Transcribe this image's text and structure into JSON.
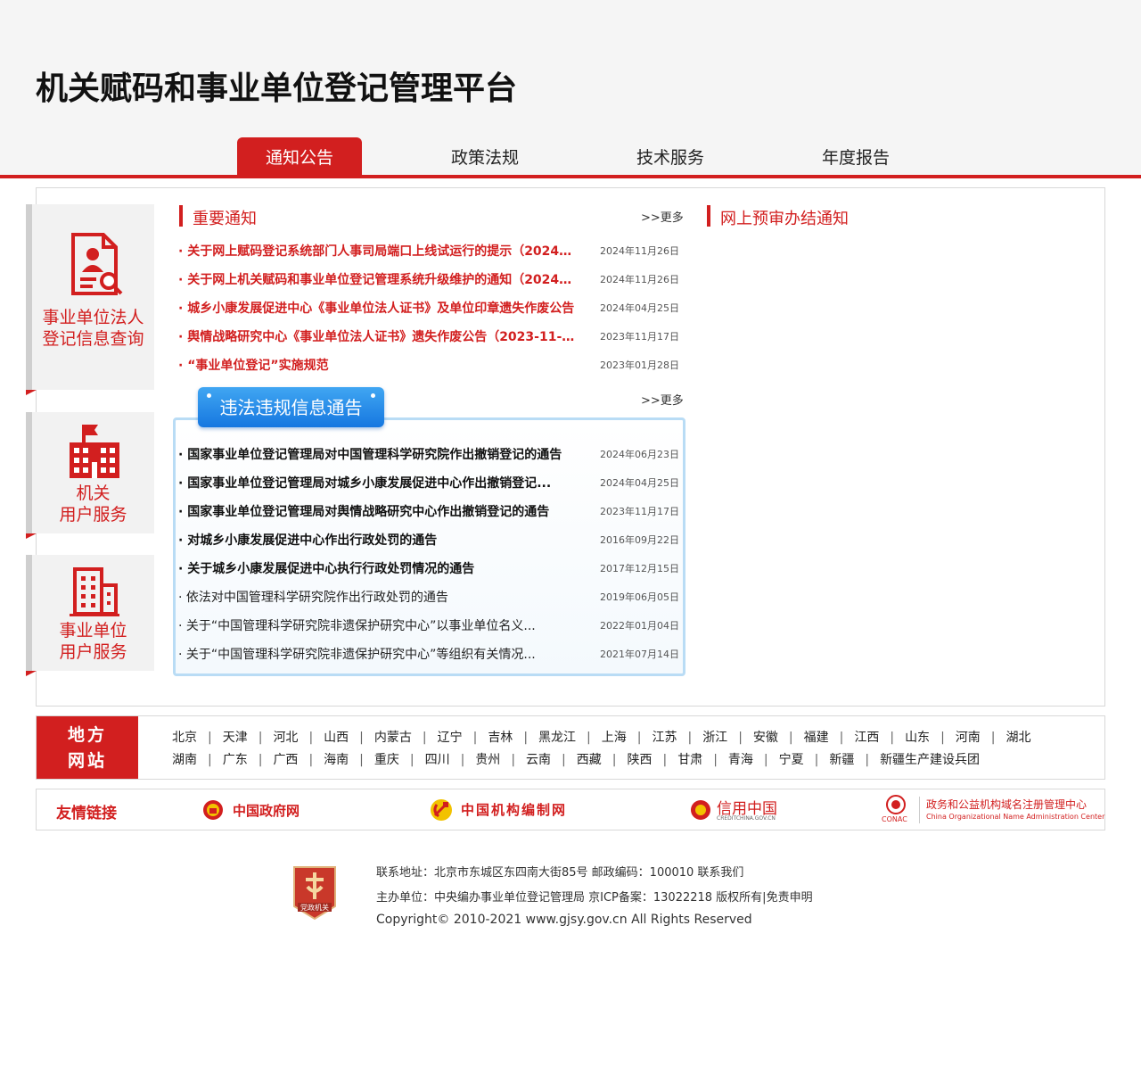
{
  "header": {
    "site_title": "机关赋码和事业单位登记管理平台",
    "nav_tabs": [
      {
        "label": "通知公告"
      },
      {
        "label": "政策法规"
      },
      {
        "label": "技术服务"
      },
      {
        "label": "年度报告"
      }
    ],
    "active_tab": "通知公告",
    "accent_color": "#d21f1f"
  },
  "sidebar": {
    "cards": [
      {
        "label_line1": "事业单位法人",
        "label_line2": "登记信息查询",
        "icon": "person-search-icon"
      },
      {
        "label_line1": "机关",
        "label_line2": "用户服务",
        "icon": "office-building-flag-icon"
      },
      {
        "label_line1": "事业单位",
        "label_line2": "用户服务",
        "icon": "building-icon"
      }
    ]
  },
  "notices": {
    "title": "重要通知",
    "more": ">>更多",
    "items": [
      {
        "text": "· 关于网上赋码登记系统部门人事司局端口上线试运行的提示（2024年11月26日）",
        "date": "2024年11月26日"
      },
      {
        "text": "· 关于网上机关赋码和事业单位登记管理系统升级维护的通知（2024年11月26日）",
        "date": "2024年11月26日"
      },
      {
        "text": "· 城乡小康发展促进中心《事业单位法人证书》及单位印章遗失作废公告",
        "date": "2024年04月25日"
      },
      {
        "text": "· 舆情战略研究中心《事业单位法人证书》遗失作废公告（2023-11-17）",
        "date": "2023年11月17日"
      },
      {
        "text": "· “事业单位登记”实施规范",
        "date": "2023年01月28日"
      }
    ]
  },
  "prereview": {
    "title": "网上预审办结通知"
  },
  "illegal": {
    "badge": "违法违规信息通告",
    "more": ">>更多",
    "items": [
      {
        "text": "· 国家事业单位登记管理局对中国管理科学研究院作出撤销登记的通告",
        "date": "2024年06月23日",
        "style": "black"
      },
      {
        "text": "· 国家事业单位登记管理局对城乡小康发展促进中心作出撤销登记...",
        "date": "2024年04月25日",
        "style": "black"
      },
      {
        "text": "· 国家事业单位登记管理局对舆情战略研究中心作出撤销登记的通告",
        "date": "2023年11月17日",
        "style": "black"
      },
      {
        "text": "· 对城乡小康发展促进中心作出行政处罚的通告",
        "date": "2016年09月22日",
        "style": "black"
      },
      {
        "text": "· 关于城乡小康发展促进中心执行行政处罚情况的通告",
        "date": "2017年12月15日",
        "style": "black"
      },
      {
        "text": "· 依法对中国管理科学研究院作出行政处罚的通告",
        "date": "2019年06月05日",
        "style": "normal"
      },
      {
        "text": "· 关于“中国管理科学研究院非遗保护研究中心”以事业单位名义...",
        "date": "2022年01月04日",
        "style": "normal"
      },
      {
        "text": "· 关于“中国管理科学研究院非遗保护研究中心”等组织有关情况...",
        "date": "2021年07月14日",
        "style": "normal"
      }
    ]
  },
  "regions": {
    "tag_line1": "地方",
    "tag_line2": "网站",
    "row1": [
      "北京",
      "天津",
      "河北",
      "山西",
      "内蒙古",
      "辽宁",
      "吉林",
      "黑龙江",
      "上海",
      "江苏",
      "浙江",
      "安徽",
      "福建",
      "江西",
      "山东",
      "河南",
      "湖北"
    ],
    "row2": [
      "湖南",
      "广东",
      "广西",
      "海南",
      "重庆",
      "四川",
      "贵州",
      "云南",
      "西藏",
      "陕西",
      "甘肃",
      "青海",
      "宁夏",
      "新疆",
      "新疆生产建设兵团"
    ]
  },
  "friend_links": {
    "tag": "友情链接",
    "items": [
      {
        "label": "中国政府网",
        "icon": "national-emblem-icon"
      },
      {
        "label": "中国机构编制网",
        "icon": "party-emblem-icon"
      },
      {
        "label": "信用中国",
        "sub": "CREDITCHINA.GOV.CN",
        "icon": "credit-china-icon"
      },
      {
        "label": "政务和公益机构域名注册管理中心",
        "sub": "China Organizational Name Administration Center",
        "abbr": "CONAC",
        "icon": "conac-logo-icon"
      }
    ]
  },
  "footer": {
    "logo_text": "党政机关",
    "line1": "联系地址：北京市东城区东四南大街85号 邮政编码：100010 联系我们",
    "line2": "主办单位：中央编办事业单位登记管理局 京ICP备案：13022218 版权所有|免责申明",
    "line3": "Copyright© 2010-2021 www.gjsy.gov.cn All Rights Reserved"
  }
}
